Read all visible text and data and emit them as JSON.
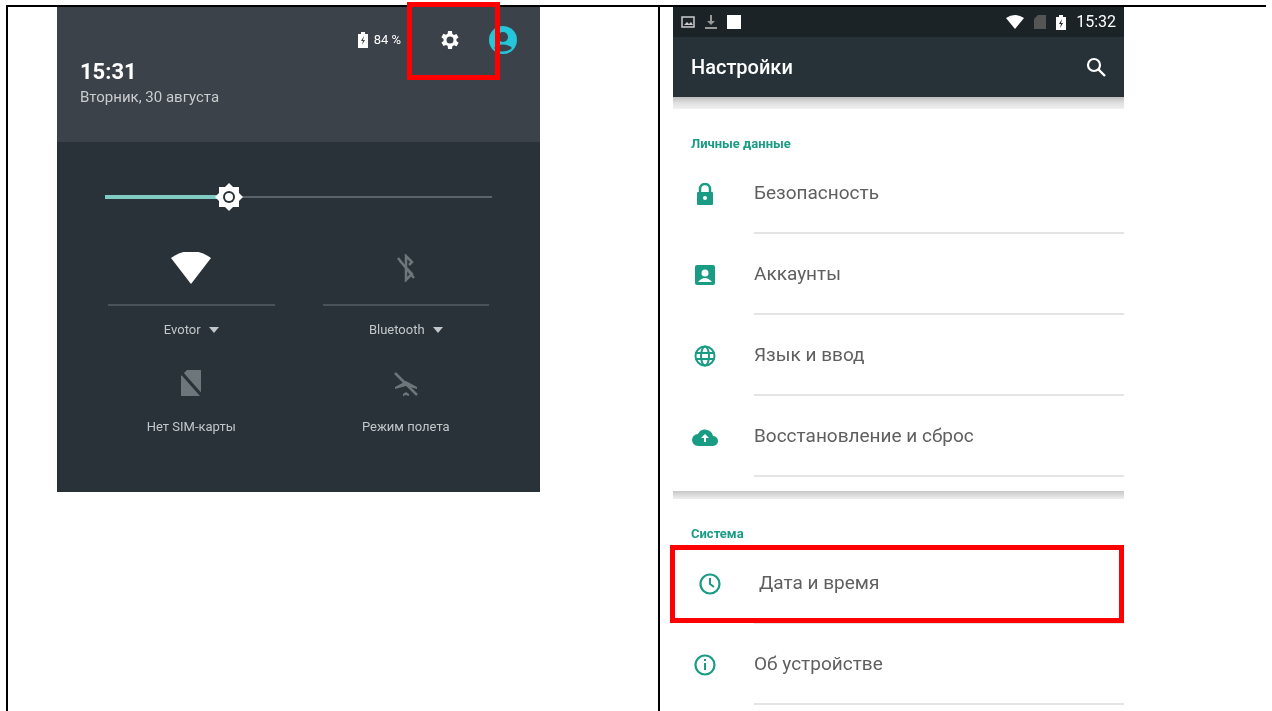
{
  "quick_settings": {
    "battery": "84 %",
    "settings_highlighted": true,
    "time": "15:31",
    "date": "Вторник, 30 августа",
    "brightness": {
      "level": 0.32
    },
    "tiles": [
      {
        "label": "Evotor",
        "on": true,
        "dropdown": true
      },
      {
        "label": "Bluetooth",
        "on": false,
        "dropdown": true
      },
      {
        "label": "Нет SIM-карты",
        "on": false,
        "dropdown": false
      },
      {
        "label": "Режим полета",
        "on": false,
        "dropdown": false
      }
    ]
  },
  "settings_screen": {
    "status_time": "15:32",
    "title": "Настройки",
    "sections": [
      {
        "title": "Личные данные",
        "items": [
          {
            "label": "Безопасность",
            "highlighted": false
          },
          {
            "label": "Аккаунты",
            "highlighted": false
          },
          {
            "label": "Язык и ввод",
            "highlighted": false
          },
          {
            "label": "Восстановление и сброс",
            "highlighted": false
          }
        ]
      },
      {
        "title": "Система",
        "items": [
          {
            "label": "Дата и время",
            "highlighted": true
          },
          {
            "label": "Об устройстве",
            "highlighted": false
          }
        ]
      }
    ]
  }
}
